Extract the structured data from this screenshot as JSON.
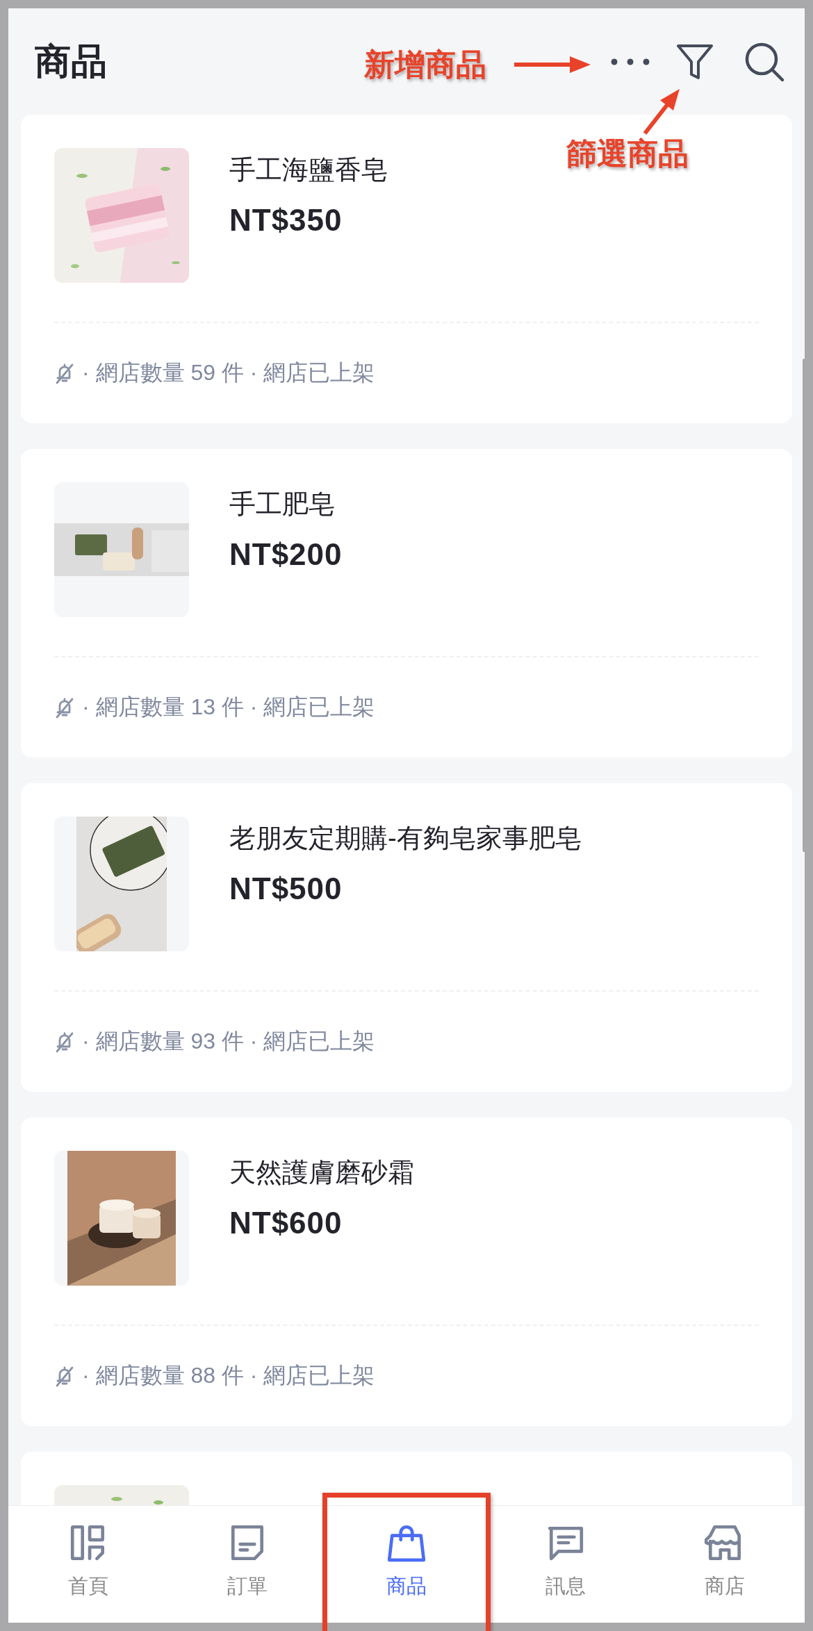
{
  "header": {
    "title": "商品"
  },
  "annotations": [
    {
      "kind": "arrow-label",
      "text": "新增商品"
    },
    {
      "kind": "arrow-label",
      "text": "篩選商品"
    },
    {
      "kind": "frame"
    }
  ],
  "products": [
    {
      "name": "手工海鹽香皂",
      "price": "NT$350",
      "meta": "· 網店數量 59 件 · 網店已上架"
    },
    {
      "name": "手工肥皂",
      "price": "NT$200",
      "meta": "· 網店數量 13 件 · 網店已上架"
    },
    {
      "name": "老朋友定期購-有夠皂家事肥皂",
      "price": "NT$500",
      "meta": "· 網店數量 93 件 · 網店已上架"
    },
    {
      "name": "天然護膚磨砂霜",
      "price": "NT$600",
      "meta": "· 網店數量 88 件 · 網店已上架"
    }
  ],
  "nav": [
    {
      "label": "首頁",
      "selected": false
    },
    {
      "label": "訂單",
      "selected": false
    },
    {
      "label": "商品",
      "selected": true
    },
    {
      "label": "訊息",
      "selected": false
    },
    {
      "label": "商店",
      "selected": false
    }
  ]
}
